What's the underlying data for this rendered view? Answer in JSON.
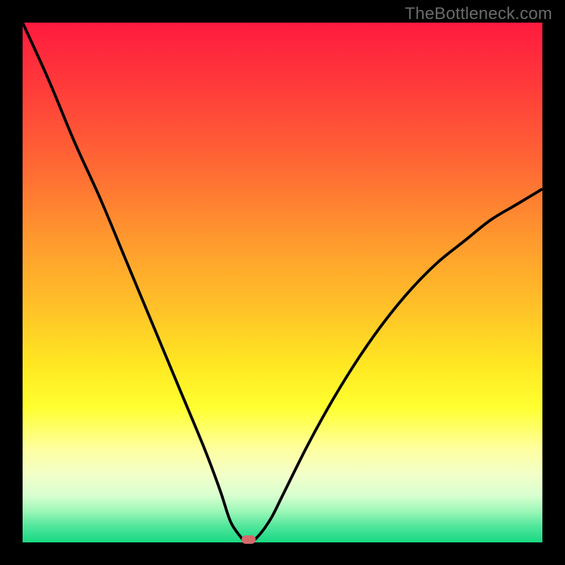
{
  "watermark": "TheBottleneck.com",
  "colors": {
    "frame": "#000000",
    "curve": "#000000",
    "marker": "#d46a6a",
    "gradient_top": "#ff1a3f",
    "gradient_bottom": "#18d882"
  },
  "chart_data": {
    "type": "line",
    "title": "",
    "xlabel": "",
    "ylabel": "",
    "xlim": [
      0,
      100
    ],
    "ylim": [
      0,
      100
    ],
    "x": [
      0,
      5,
      10,
      15,
      20,
      25,
      30,
      35,
      38,
      40,
      42,
      43,
      44,
      46,
      48,
      50,
      55,
      60,
      65,
      70,
      75,
      80,
      85,
      90,
      95,
      100
    ],
    "values": [
      100,
      89,
      77,
      66,
      54,
      42,
      30,
      18,
      10,
      4,
      1,
      0,
      0,
      2,
      5,
      9,
      19,
      28,
      36,
      43,
      49,
      54,
      58,
      62,
      65,
      68
    ],
    "marker": {
      "x": 43.5,
      "y": 0
    },
    "annotations": []
  }
}
